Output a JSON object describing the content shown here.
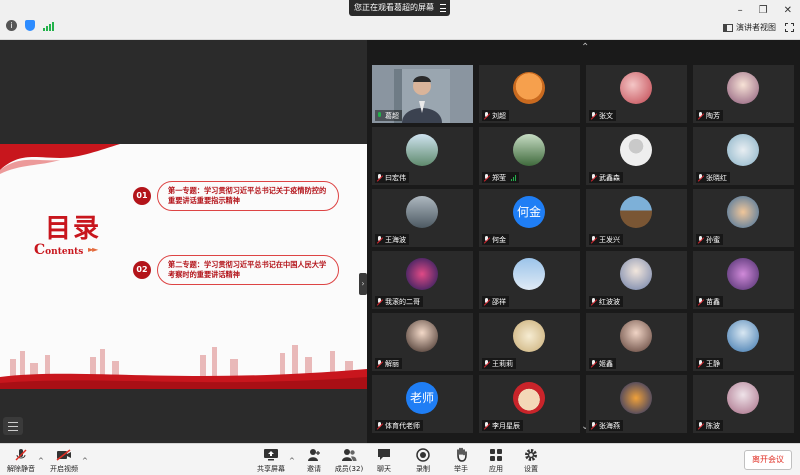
{
  "topbar": {
    "share_banner": "您正在观看葛超的屏幕",
    "view_label": "演讲者视图"
  },
  "slide": {
    "title": "目录",
    "subtitle_cap": "C",
    "subtitle_rest": "ontents",
    "topics": [
      {
        "num": "01",
        "text": "第一专题：学习贯彻习近平总书记关于疫情防控的重要讲话重要指示精神"
      },
      {
        "num": "02",
        "text": "第二专题：学习贯彻习近平总书记在中国人民大学考察时的重要讲话精神"
      }
    ]
  },
  "gallery": {
    "participants": [
      {
        "name": "葛超",
        "avatar": "video",
        "mic": "active"
      },
      {
        "name": "刘超",
        "avatar": "cartoon-orange",
        "mic": "muted"
      },
      {
        "name": "张文",
        "avatar": "flowers",
        "mic": "muted"
      },
      {
        "name": "陶芳",
        "avatar": "cartoon-girl",
        "mic": "muted"
      },
      {
        "name": "曰宏伟",
        "avatar": "landscape",
        "mic": "muted"
      },
      {
        "name": "郑莹",
        "avatar": "landscape-green",
        "mic": "muted"
      },
      {
        "name": "武鑫森",
        "avatar": "default-person",
        "mic": "muted"
      },
      {
        "name": "张晓红",
        "avatar": "flowers-blue",
        "mic": "muted"
      },
      {
        "name": "王海波",
        "avatar": "airplane",
        "mic": "muted"
      },
      {
        "name": "何金",
        "avatar_text": "何金",
        "avatar": "text",
        "mic": "muted"
      },
      {
        "name": "王发兴",
        "avatar": "horse",
        "mic": "muted"
      },
      {
        "name": "孙蜜",
        "avatar": "cartoon-kid",
        "mic": "muted"
      },
      {
        "name": "我滚的二哥",
        "avatar": "fireworks",
        "mic": "muted"
      },
      {
        "name": "邵祥",
        "avatar": "sky",
        "mic": "muted"
      },
      {
        "name": "红波波",
        "avatar": "anime",
        "mic": "muted"
      },
      {
        "name": "苗鑫",
        "avatar": "purple-flower",
        "mic": "muted"
      },
      {
        "name": "解丽",
        "avatar": "woman",
        "mic": "muted"
      },
      {
        "name": "王莉莉",
        "avatar": "cartoon-cream",
        "mic": "muted"
      },
      {
        "name": "姬鑫",
        "avatar": "woman2",
        "mic": "muted"
      },
      {
        "name": "王静",
        "avatar": "kid-blue",
        "mic": "muted"
      },
      {
        "name": "体育代老师",
        "avatar_text": "老师",
        "avatar": "text",
        "mic": "muted"
      },
      {
        "name": "李月星辰",
        "avatar": "cartoon-hat",
        "mic": "muted"
      },
      {
        "name": "张海燕",
        "avatar": "night-scene",
        "mic": "muted"
      },
      {
        "name": "陈波",
        "avatar": "photo-woman",
        "mic": "muted"
      }
    ]
  },
  "toolbar": {
    "unmute": "解除静音",
    "start_video": "开启视频",
    "share_screen": "共享屏幕",
    "invite": "邀请",
    "participants": "成员(32)",
    "chat": "聊天",
    "record": "录制",
    "raise_hand": "举手",
    "apps": "应用",
    "settings": "设置",
    "leave": "离开会议"
  },
  "colors": {
    "accent_red": "#c8161d",
    "mic_active": "#23b24b",
    "avatar_blue": "#1f7ef5"
  }
}
